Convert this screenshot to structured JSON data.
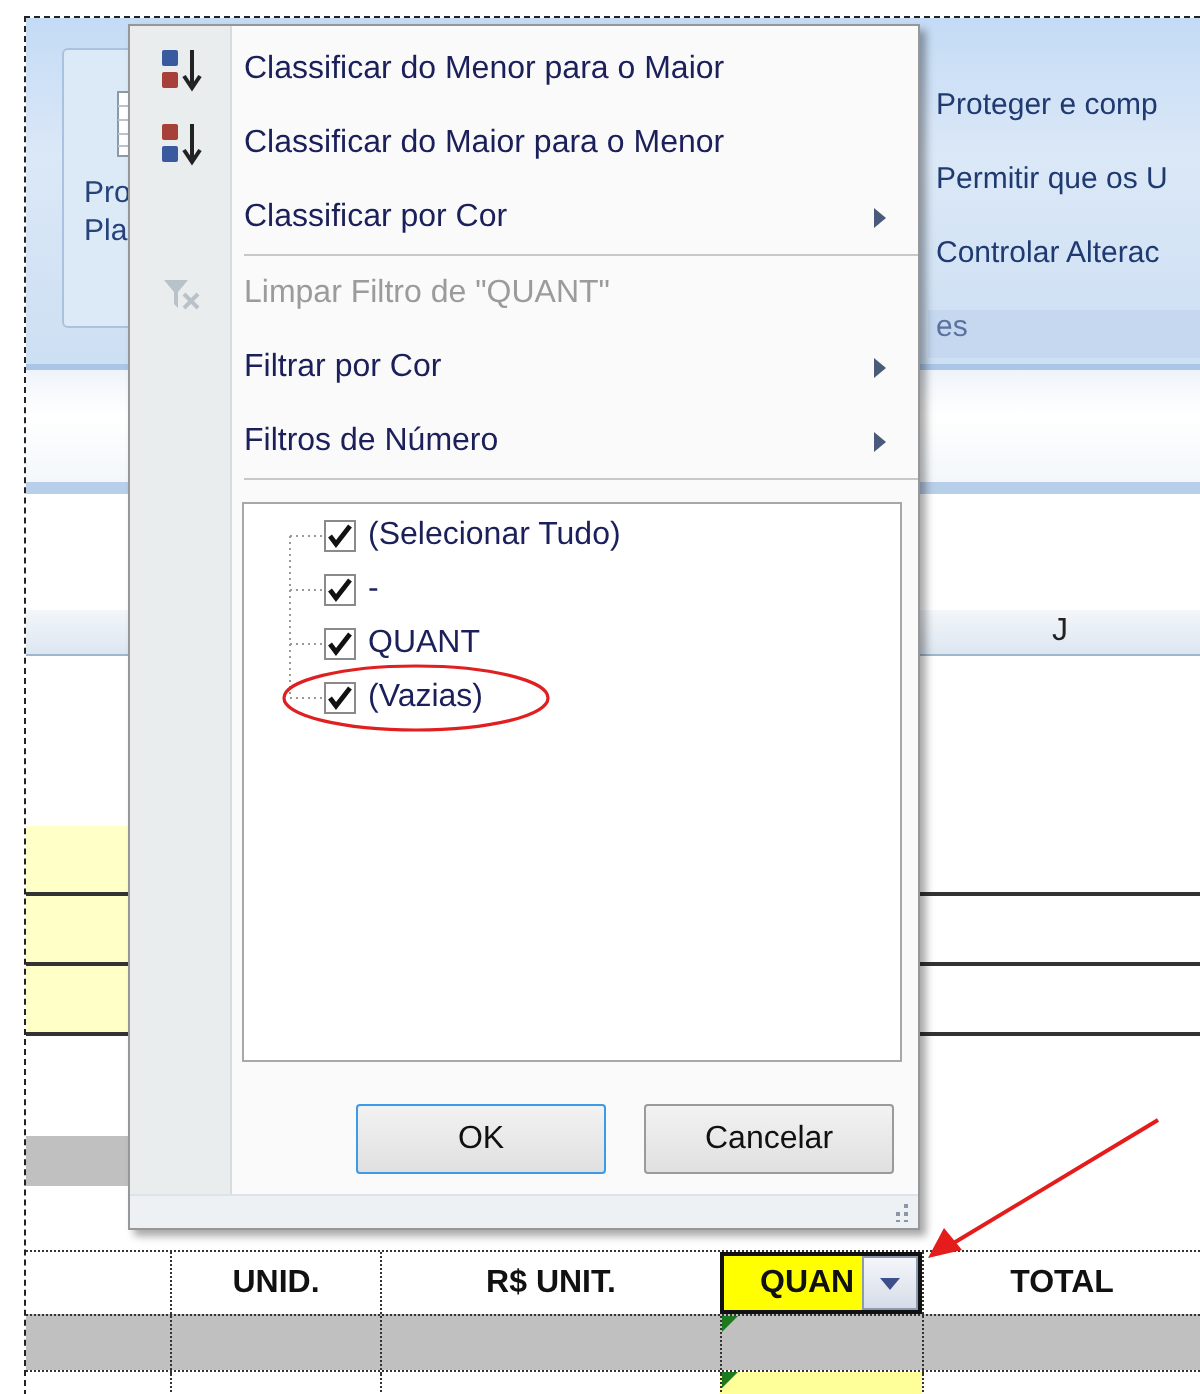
{
  "ribbon": {
    "left_group_label_lines": [
      "Pro",
      "Pla"
    ],
    "right_commands": [
      "Proteger e comp",
      "Permitir que os U",
      "Controlar Alterac"
    ],
    "right_group_label": "es"
  },
  "column_header": {
    "label": "J"
  },
  "header_row": [
    {
      "text": "UNID.",
      "filter": false
    },
    {
      "text": "R$ UNIT.",
      "filter": false
    },
    {
      "text": "QUAN",
      "filter": true
    },
    {
      "text": "TOTAL",
      "filter": false
    }
  ],
  "filter_menu": {
    "items": [
      {
        "kind": "sort_asc",
        "label": "Classificar do Menor para o Maior",
        "disabled": false,
        "submenu": false
      },
      {
        "kind": "sort_desc",
        "label": "Classificar do Maior para o Menor",
        "disabled": false,
        "submenu": false
      },
      {
        "kind": "item",
        "label": "Classificar por Cor",
        "disabled": false,
        "submenu": true
      },
      {
        "kind": "separator"
      },
      {
        "kind": "clear_filter",
        "label": "Limpar Filtro de \"QUANT\"",
        "disabled": true,
        "submenu": false
      },
      {
        "kind": "item",
        "label": "Filtrar por Cor",
        "disabled": false,
        "submenu": true
      },
      {
        "kind": "item",
        "label": "Filtros de Número",
        "disabled": false,
        "submenu": true
      },
      {
        "kind": "separator"
      }
    ],
    "values": [
      {
        "label": "(Selecionar Tudo)",
        "checked": true,
        "circled": false
      },
      {
        "label": "-",
        "checked": true,
        "circled": false
      },
      {
        "label": "QUANT",
        "checked": true,
        "circled": false
      },
      {
        "label": "(Vazias)",
        "checked": true,
        "circled": true
      }
    ],
    "buttons": [
      "OK",
      "Cancelar"
    ]
  }
}
